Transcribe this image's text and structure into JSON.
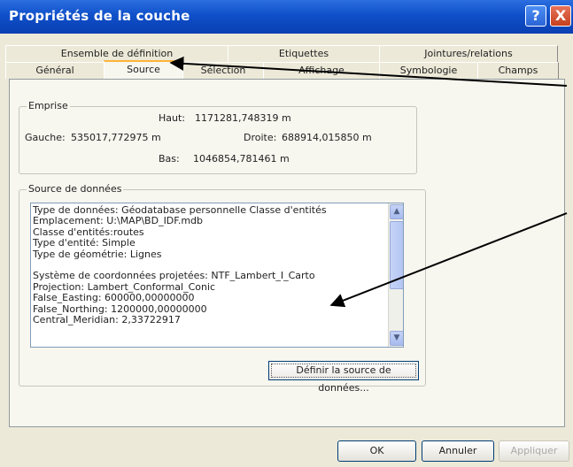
{
  "window": {
    "title": "Propriétés de la couche",
    "help_label": "?",
    "close_label": "X"
  },
  "tabs_back": [
    "Ensemble de définition",
    "Etiquettes",
    "Jointures/relations"
  ],
  "tabs_front": [
    "Général",
    "Source",
    "Sélection",
    "Affichage",
    "Symbologie",
    "Champs"
  ],
  "active_tab": "Source",
  "emprise": {
    "legend": "Emprise",
    "haut_label": "Haut:",
    "haut_value": "1171281,748319 m",
    "gauche_label": "Gauche:",
    "gauche_value": "535017,772975 m",
    "droite_label": "Droite:",
    "droite_value": "688914,015850 m",
    "bas_label": "Bas:",
    "bas_value": "1046854,781461 m"
  },
  "source": {
    "legend": "Source de données",
    "lines": [
      "Type de données: Géodatabase personnelle Classe d'entités",
      "Emplacement: U:\\MAP\\BD_IDF.mdb",
      "Classe d'entités:routes",
      "Type d'entité: Simple",
      "Type de géométrie: Lignes",
      "",
      "Système de coordonnées projetées: NTF_Lambert_I_Carto",
      "Projection: Lambert_Conformal_Conic",
      "False_Easting: 600000,00000000",
      "False_Northing: 1200000,00000000",
      "Central_Meridian: 2,33722917"
    ],
    "set_source_label": "Définir la source de données..."
  },
  "buttons": {
    "ok": "OK",
    "cancel": "Annuler",
    "apply": "Appliquer"
  }
}
